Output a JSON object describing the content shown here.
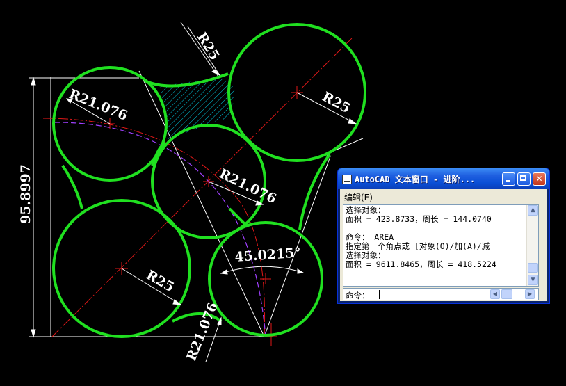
{
  "drawing": {
    "dimensions": {
      "radius_top_left": "R21.076",
      "radius_top": "R25",
      "radius_top_right": "R25",
      "radius_center": "R21.076",
      "radius_bottom_left": "R25",
      "radius_bottom": "R21.076",
      "height": "95.8997",
      "angle": "45.0215°"
    },
    "colors": {
      "circle": "#20e020",
      "centerline": "#e01818",
      "dimension": "#ffffff",
      "hatch": "#00c8e0",
      "arc_dashed": "#a040ff",
      "background": "#000000"
    }
  },
  "text_window": {
    "title": "AutoCAD 文本窗口 - 进阶...",
    "menu": "编辑(E)",
    "icons": [
      "app-icon",
      "minimize-icon",
      "maximize-icon",
      "close-icon"
    ],
    "history": [
      "选择对象：",
      "面积 = 423.8733，周长 = 144.0740",
      "",
      "命令： AREA",
      "指定第一个角点或 [对象(O)/加(A)/减",
      "选择对象：",
      "面积 = 9611.8465，周长 = 418.5224"
    ],
    "command_prompt": "命令："
  }
}
